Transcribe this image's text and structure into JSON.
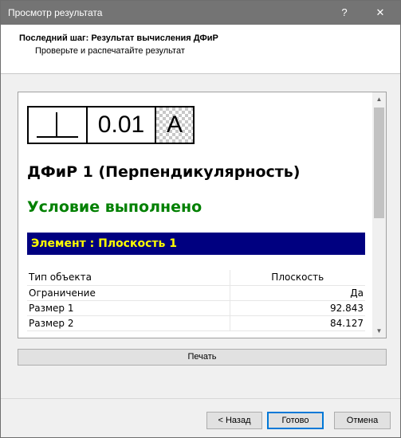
{
  "window": {
    "title": "Просмотр результата",
    "help_label": "?",
    "close_label": "✕"
  },
  "header": {
    "title": "Последний шаг: Результат вычисления ДФиР",
    "subtitle": "Проверьте и распечатайте результат"
  },
  "report": {
    "frame": {
      "symbol": "perpendicularity-icon",
      "tolerance": "0.01",
      "datum": "A"
    },
    "feature_title": "ДФиР 1 (Перпендикулярность)",
    "condition": "Условие выполнено",
    "condition_color": "#008000",
    "element_label": "Элемент : Плоскость 1",
    "element_bar_color": "#000080",
    "element_text_color": "#ffff00",
    "properties": [
      {
        "key": "Тип объекта",
        "value": "Плоскость"
      },
      {
        "key": "Ограничение",
        "value": "Да"
      },
      {
        "key": "Размер 1",
        "value": "92.843"
      },
      {
        "key": "Размер 2",
        "value": "84.127"
      }
    ]
  },
  "buttons": {
    "print": "Печать",
    "back": "< Назад",
    "done": "Готово",
    "cancel": "Отмена"
  }
}
